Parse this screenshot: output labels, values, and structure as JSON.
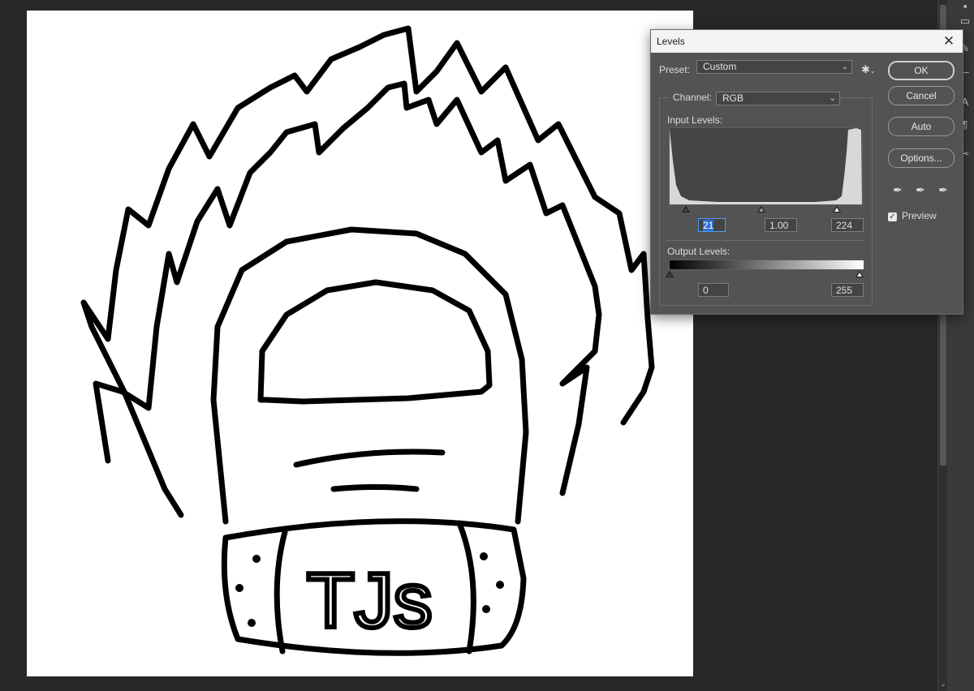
{
  "dialog": {
    "title": "Levels",
    "preset_label": "Preset:",
    "preset_value": "Custom",
    "channel_label": "Channel:",
    "channel_value": "RGB",
    "input_levels_label": "Input Levels:",
    "input_black": "21",
    "input_gamma": "1.00",
    "input_white": "224",
    "output_levels_label": "Output Levels:",
    "output_black": "0",
    "output_white": "255",
    "buttons": {
      "ok": "OK",
      "cancel": "Cancel",
      "auto": "Auto",
      "options": "Options..."
    },
    "preview_label": "Preview",
    "preview_checked": true
  },
  "artwork_text": "TJs",
  "icons": {
    "close": "close-icon",
    "gear": "gear-icon",
    "eyedroppers": [
      "black-eyedropper-icon",
      "gray-eyedropper-icon",
      "white-eyedropper-icon"
    ]
  }
}
